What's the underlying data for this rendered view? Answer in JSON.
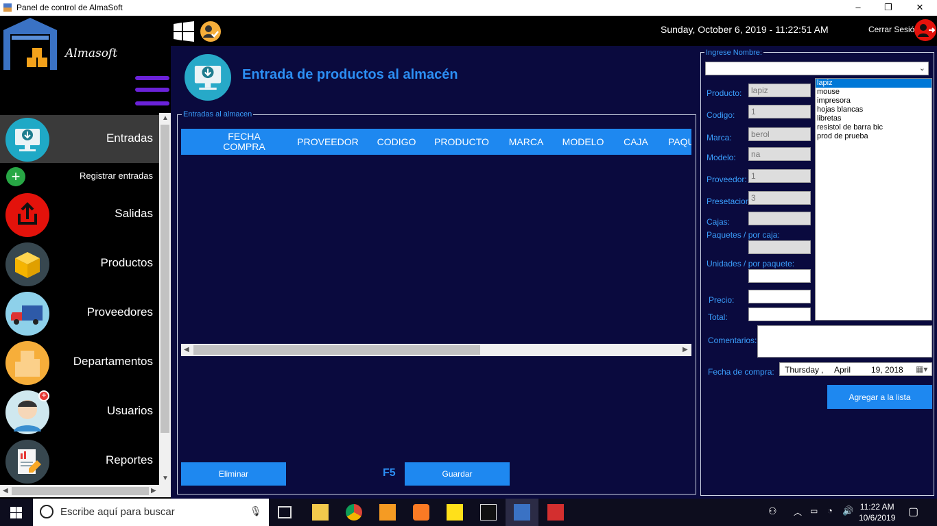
{
  "window": {
    "title": "Panel de control de AlmaSoft",
    "min": "–",
    "max": "❐",
    "close": "✕"
  },
  "brand": {
    "name": "Almasoft"
  },
  "topbar": {
    "datetime": "Sunday, October 6, 2019 - 11:22:51 AM",
    "logout_label": "Cerrar Sesión"
  },
  "sidebar": {
    "entradas": "Entradas",
    "registrar": "Registrar entradas",
    "salidas": "Salidas",
    "productos": "Productos",
    "proveedores": "Proveedores",
    "departamentos": "Departamentos",
    "usuarios": "Usuarios",
    "reportes": "Reportes"
  },
  "main": {
    "title": "Entrada de productos al almacén",
    "group_label": "Entradas al almacen",
    "columns": [
      "FECHA COMPRA",
      "PROVEEDOR",
      "CODIGO",
      "PRODUCTO",
      "MARCA",
      "MODELO",
      "CAJA",
      "PAQU"
    ],
    "delete_label": "Eliminar",
    "shortcut": "F5",
    "save_label": "Guardar"
  },
  "form": {
    "group_label": "Ingrese Nombre:",
    "name_value": "",
    "producto_label": "Producto:",
    "producto_value": "lapiz",
    "codigo_label": "Codigo:",
    "codigo_value": "1",
    "marca_label": "Marca:",
    "marca_value": "berol",
    "modelo_label": "Modelo:",
    "modelo_value": "na",
    "proveedor_label": "Proveedor:",
    "proveedor_value": "1",
    "presentacion_label": "Presetacion:",
    "presentacion_value": "3",
    "cajas_label": "Cajas:",
    "cajas_value": "",
    "paquetes_label": "Paquetes / por caja:",
    "paquetes_value": "",
    "unidades_label": "Unidades / por paquete:",
    "unidades_value": "",
    "precio_label": "Precio:",
    "precio_value": "",
    "total_label": "Total:",
    "total_value": "",
    "comentarios_label": "Comentarios:",
    "comentarios_value": "",
    "fecha_label": "Fecha de compra:",
    "fecha_day": "Thursday",
    "fecha_sep": ",",
    "fecha_month": "April",
    "fecha_date": "19, 2018",
    "add_label": "Agregar a la lista",
    "list_items": [
      "lapiz",
      "mouse",
      "impresora",
      "hojas blancas",
      "libretas",
      "resistol de barra bic",
      "prod de prueba"
    ],
    "list_selected": "lapiz"
  },
  "taskbar": {
    "search_placeholder": "Escribe aquí para buscar",
    "time": "11:22 AM",
    "date": "10/6/2019"
  }
}
